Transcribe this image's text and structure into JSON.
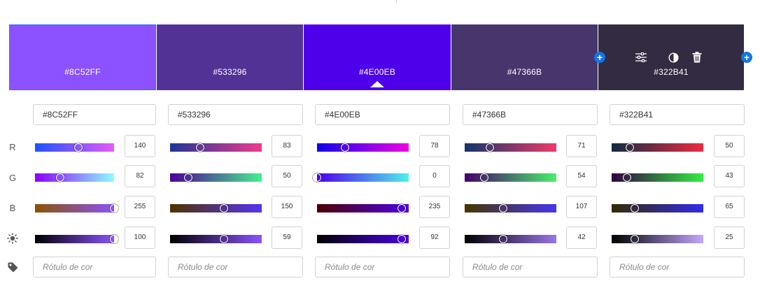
{
  "colors": [
    {
      "hex": "#8C52FF",
      "swatch": "#8c52ff",
      "selected": true,
      "label_placeholder": "Rótulo de cor",
      "r": {
        "value": 140,
        "display": "140",
        "from": "#1e52ff",
        "to": "#e65bf7"
      },
      "g": {
        "value": 82,
        "display": "82",
        "from": "#8c00ff",
        "to": "#8cfdff"
      },
      "b": {
        "value": 255,
        "display": "255",
        "from": "#8c5200",
        "to": "#8c52ff"
      },
      "brightness": {
        "value": 100,
        "display": "100",
        "from": "#000000",
        "to": "#8c52ff"
      }
    },
    {
      "hex": "#533296",
      "swatch": "#533296",
      "selected": false,
      "label_placeholder": "Rótulo de cor",
      "r": {
        "value": 83,
        "display": "83",
        "from": "#1d3796",
        "to": "#ef3a8e"
      },
      "g": {
        "value": 50,
        "display": "50",
        "from": "#4e009a",
        "to": "#44f08c"
      },
      "b": {
        "value": 150,
        "display": "150",
        "from": "#503200",
        "to": "#5434f3"
      },
      "brightness": {
        "value": 59,
        "display": "59",
        "from": "#000000",
        "to": "#8c52ff"
      }
    },
    {
      "hex": "#4E00EB",
      "swatch": "#4e00eb",
      "selected": false,
      "label_placeholder": "Rótulo de cor",
      "r": {
        "value": 78,
        "display": "78",
        "from": "#1000eb",
        "to": "#f000e3"
      },
      "g": {
        "value": 0,
        "display": "0",
        "from": "#4e00eb",
        "to": "#4ef0eb"
      },
      "b": {
        "value": 235,
        "display": "235",
        "from": "#4e0000",
        "to": "#4e00eb"
      },
      "brightness": {
        "value": 92,
        "display": "92",
        "from": "#000000",
        "to": "#4e00eb"
      }
    },
    {
      "hex": "#47366B",
      "swatch": "#47366b",
      "selected": false,
      "label_placeholder": "Rótulo de cor",
      "r": {
        "value": 71,
        "display": "71",
        "from": "#12366b",
        "to": "#ee3a6a"
      },
      "g": {
        "value": 54,
        "display": "54",
        "from": "#47006b",
        "to": "#47f06b"
      },
      "b": {
        "value": 107,
        "display": "107",
        "from": "#473600",
        "to": "#4736ee"
      },
      "brightness": {
        "value": 42,
        "display": "42",
        "from": "#000000",
        "to": "#9a75e8"
      }
    },
    {
      "hex": "#322B41",
      "swatch": "#322b41",
      "selected": false,
      "label_placeholder": "Rótulo de cor",
      "r": {
        "value": 50,
        "display": "50",
        "from": "#0e2b41",
        "to": "#ec2b41"
      },
      "g": {
        "value": 43,
        "display": "43",
        "from": "#320041",
        "to": "#32ee41"
      },
      "b": {
        "value": 65,
        "display": "65",
        "from": "#322b00",
        "to": "#322bee"
      },
      "brightness": {
        "value": 25,
        "display": "25",
        "from": "#000000",
        "to": "#c2a8ff"
      }
    }
  ],
  "row_labels": {
    "r": "R",
    "g": "G",
    "b": "B",
    "brightness": "brightness-icon",
    "label": "tag-icon"
  },
  "toolbar_icons": [
    "add-color-icon",
    "adjust-icon",
    "contrast-icon",
    "trash-icon",
    "add-color-icon"
  ]
}
